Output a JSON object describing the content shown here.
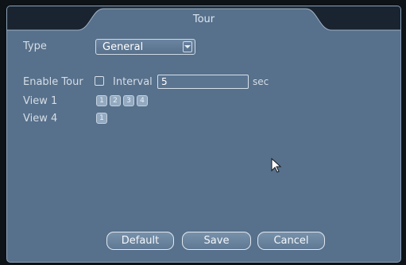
{
  "dialog": {
    "title": "Tour"
  },
  "type": {
    "label": "Type",
    "selected": "General"
  },
  "tour": {
    "enable_label": "Enable Tour",
    "enabled": false,
    "interval_label": "Interval",
    "interval_value": "5",
    "unit": "sec"
  },
  "views": [
    {
      "label": "View 1",
      "channels": [
        "1",
        "2",
        "3",
        "4"
      ]
    },
    {
      "label": "View 4",
      "channels": [
        "1"
      ]
    }
  ],
  "buttons": {
    "default": "Default",
    "save": "Save",
    "cancel": "Cancel"
  },
  "colors": {
    "panel": "#57708b",
    "border": "#8ba1b8",
    "titlebar": "#1a2430",
    "chip": "#93a9c0"
  }
}
